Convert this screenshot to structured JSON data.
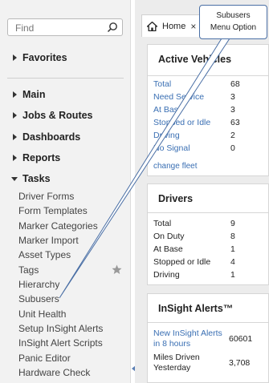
{
  "sidebar": {
    "search_placeholder": "Find",
    "sections": {
      "favorites": "Favorites",
      "main": "Main",
      "jobs_routes": "Jobs & Routes",
      "dashboards": "Dashboards",
      "reports": "Reports",
      "tasks": "Tasks"
    },
    "tasks": [
      "Driver Forms",
      "Form Templates",
      "Marker Categories",
      "Marker Import",
      "Asset Types",
      "Tags",
      "Hierarchy",
      "Subusers",
      "Unit Health",
      "Setup InSight Alerts",
      "InSight Alert Scripts",
      "Panic Editor",
      "Hardware Check"
    ]
  },
  "tabs": {
    "home_label": "Home",
    "close_glyph": "×"
  },
  "active_vehicles": {
    "title": "Active Vehicles",
    "rows": [
      {
        "label": "Total",
        "value": "68"
      },
      {
        "label": "Need Service",
        "value": "3"
      },
      {
        "label": "At Base",
        "value": "3"
      },
      {
        "label": "Stopped or Idle",
        "value": "63"
      },
      {
        "label": "Driving",
        "value": "2"
      },
      {
        "label": "No Signal",
        "value": "0"
      }
    ],
    "change_fleet": "change fleet"
  },
  "drivers": {
    "title": "Drivers",
    "rows": [
      {
        "label": "Total",
        "value": "9"
      },
      {
        "label": "On Duty",
        "value": "8"
      },
      {
        "label": "At Base",
        "value": "1"
      },
      {
        "label": "Stopped or Idle",
        "value": "4"
      },
      {
        "label": "Driving",
        "value": "1"
      }
    ]
  },
  "insight_alerts": {
    "title": "InSight Alerts™",
    "rows": [
      {
        "label_line1": "New InSight Alerts",
        "label_line2": "in 8 hours",
        "value": "60601"
      },
      {
        "label_line1": "Miles Driven",
        "label_line2": "Yesterday",
        "value": "3,708"
      }
    ]
  },
  "callout": {
    "line1": "Subusers",
    "line2": "Menu Option"
  },
  "icons": {
    "search": "search-icon",
    "caret_right": "caret-right-icon",
    "caret_down": "caret-down-icon",
    "home": "home-icon",
    "star": "star-icon",
    "collapse": "chevron-left-icon"
  },
  "colors": {
    "link": "#3a6fb3",
    "sidebar_bg": "#f2f2f2",
    "callout_border": "#4a6fa5"
  }
}
